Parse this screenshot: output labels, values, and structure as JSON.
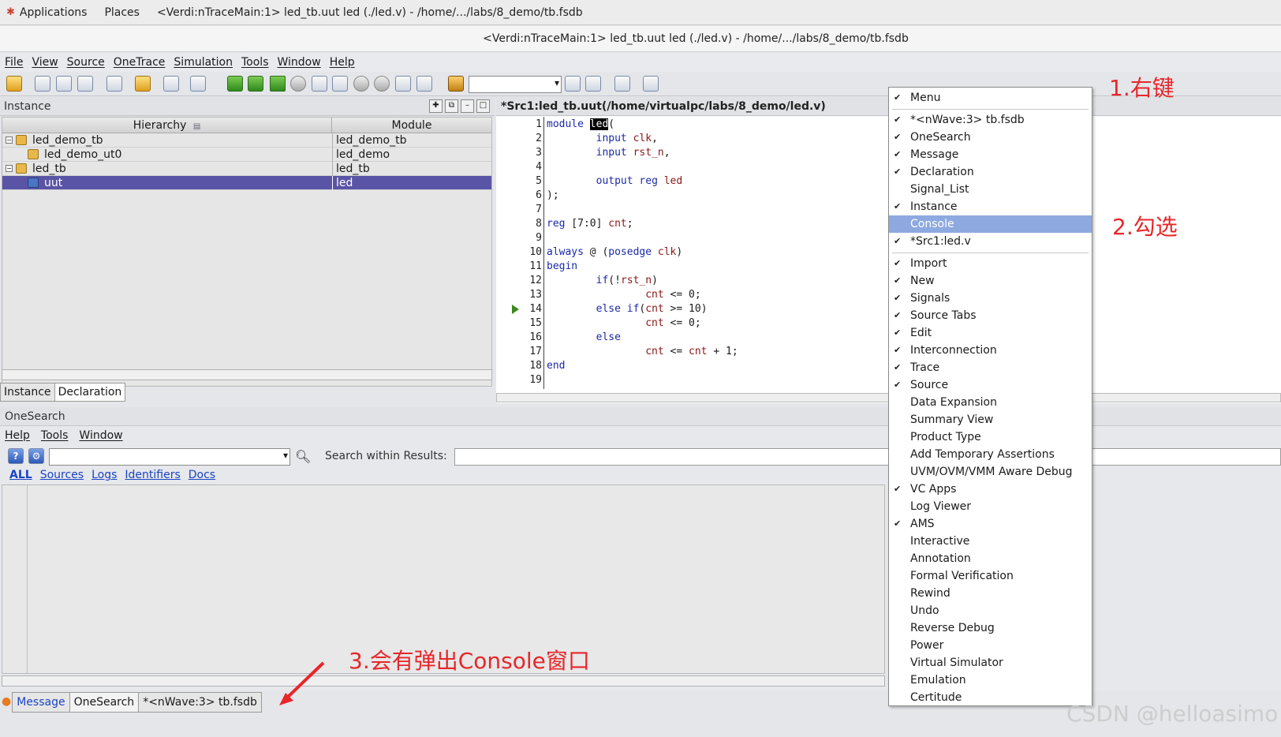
{
  "system_bar": {
    "applications": "Applications",
    "places": "Places",
    "window_title": "<Verdi:nTraceMain:1> led_tb.uut led (./led.v) - /home/.../labs/8_demo/tb.fsdb"
  },
  "title_bar": {
    "title": "<Verdi:nTraceMain:1> led_tb.uut led (./led.v) - /home/.../labs/8_demo/tb.fsdb"
  },
  "menubar": [
    "File",
    "View",
    "Source",
    "OneTrace",
    "Simulation",
    "Tools",
    "Window",
    "Help"
  ],
  "instance_panel": {
    "title": "Instance",
    "col_hierarchy": "Hierarchy",
    "col_module": "Module",
    "rows": [
      {
        "name": "led_demo_tb",
        "module": "led_demo_tb"
      },
      {
        "name": "led_demo_ut0",
        "module": "led_demo"
      },
      {
        "name": "led_tb",
        "module": "led_tb"
      },
      {
        "name": "uut",
        "module": "led"
      }
    ],
    "tabs": [
      "Instance",
      "Declaration"
    ]
  },
  "source_panel": {
    "title": "*Src1:led_tb.uut(/home/virtualpc/labs/8_demo/led.v)",
    "lines": [
      {
        "n": "1",
        "text": "module led("
      },
      {
        "n": "2",
        "text": "        input clk,"
      },
      {
        "n": "3",
        "text": "        input rst_n,"
      },
      {
        "n": "4",
        "text": ""
      },
      {
        "n": "5",
        "text": "        output reg led"
      },
      {
        "n": "6",
        "text": ");"
      },
      {
        "n": "7",
        "text": ""
      },
      {
        "n": "8",
        "text": "reg [7:0] cnt;"
      },
      {
        "n": "9",
        "text": ""
      },
      {
        "n": "10",
        "text": "always @ (posedge clk)"
      },
      {
        "n": "11",
        "text": "begin"
      },
      {
        "n": "12",
        "text": "        if(!rst_n)"
      },
      {
        "n": "13",
        "text": "                cnt <= 0;"
      },
      {
        "n": "14",
        "text": "        else if(cnt >= 10)"
      },
      {
        "n": "15",
        "text": "                cnt <= 0;"
      },
      {
        "n": "16",
        "text": "        else"
      },
      {
        "n": "17",
        "text": "                cnt <= cnt + 1;"
      },
      {
        "n": "18",
        "text": "end"
      },
      {
        "n": "19",
        "text": ""
      }
    ]
  },
  "onesearch": {
    "title": "OneSearch",
    "menu": [
      "Help",
      "Tools",
      "Window"
    ],
    "search_within_label": "Search within Results:",
    "links": [
      "ALL",
      "Sources",
      "Logs",
      "Identifiers",
      "Docs"
    ]
  },
  "bottom_tabs": [
    "Message",
    "OneSearch",
    "*<nWave:3> tb.fsdb"
  ],
  "context_menu": [
    {
      "label": "Menu",
      "checked": true
    },
    {
      "sep": true
    },
    {
      "label": "*<nWave:3> tb.fsdb",
      "checked": true
    },
    {
      "label": "OneSearch",
      "checked": true
    },
    {
      "label": "Message",
      "checked": true
    },
    {
      "label": "Declaration",
      "checked": true
    },
    {
      "label": "Signal_List",
      "checked": false
    },
    {
      "label": "Instance",
      "checked": true
    },
    {
      "label": "Console",
      "checked": false,
      "highlight": true
    },
    {
      "label": "*Src1:led.v",
      "checked": true
    },
    {
      "sep": true
    },
    {
      "label": "Import",
      "checked": true
    },
    {
      "label": "New",
      "checked": true
    },
    {
      "label": "Signals",
      "checked": true
    },
    {
      "label": "Source Tabs",
      "checked": true
    },
    {
      "label": "Edit",
      "checked": true
    },
    {
      "label": "Interconnection",
      "checked": true
    },
    {
      "label": "Trace",
      "checked": true
    },
    {
      "label": "Source",
      "checked": true
    },
    {
      "label": "Data Expansion",
      "checked": false
    },
    {
      "label": "Summary View",
      "checked": false
    },
    {
      "label": "Product Type",
      "checked": false
    },
    {
      "label": "Add Temporary Assertions",
      "checked": false
    },
    {
      "label": "UVM/OVM/VMM Aware Debug",
      "checked": false
    },
    {
      "label": "VC Apps",
      "checked": true
    },
    {
      "label": "Log Viewer",
      "checked": false
    },
    {
      "label": "AMS",
      "checked": true
    },
    {
      "label": "Interactive",
      "checked": false
    },
    {
      "label": "Annotation",
      "checked": false
    },
    {
      "label": "Formal Verification",
      "checked": false
    },
    {
      "label": "Rewind",
      "checked": false
    },
    {
      "label": "Undo",
      "checked": false
    },
    {
      "label": "Reverse Debug",
      "checked": false
    },
    {
      "label": "Power",
      "checked": false
    },
    {
      "label": "Virtual Simulator",
      "checked": false
    },
    {
      "label": "Emulation",
      "checked": false
    },
    {
      "label": "Certitude",
      "checked": false
    }
  ],
  "annotations": {
    "step1": "1.右键",
    "step2": "2.勾选",
    "step3": "3.会有弹出Console窗口"
  },
  "watermark": "CSDN @helloasimo",
  "colors": {
    "selection": "#5a54a6",
    "menu_highlight": "#8ea9e0",
    "annotation": "#e8262a"
  }
}
